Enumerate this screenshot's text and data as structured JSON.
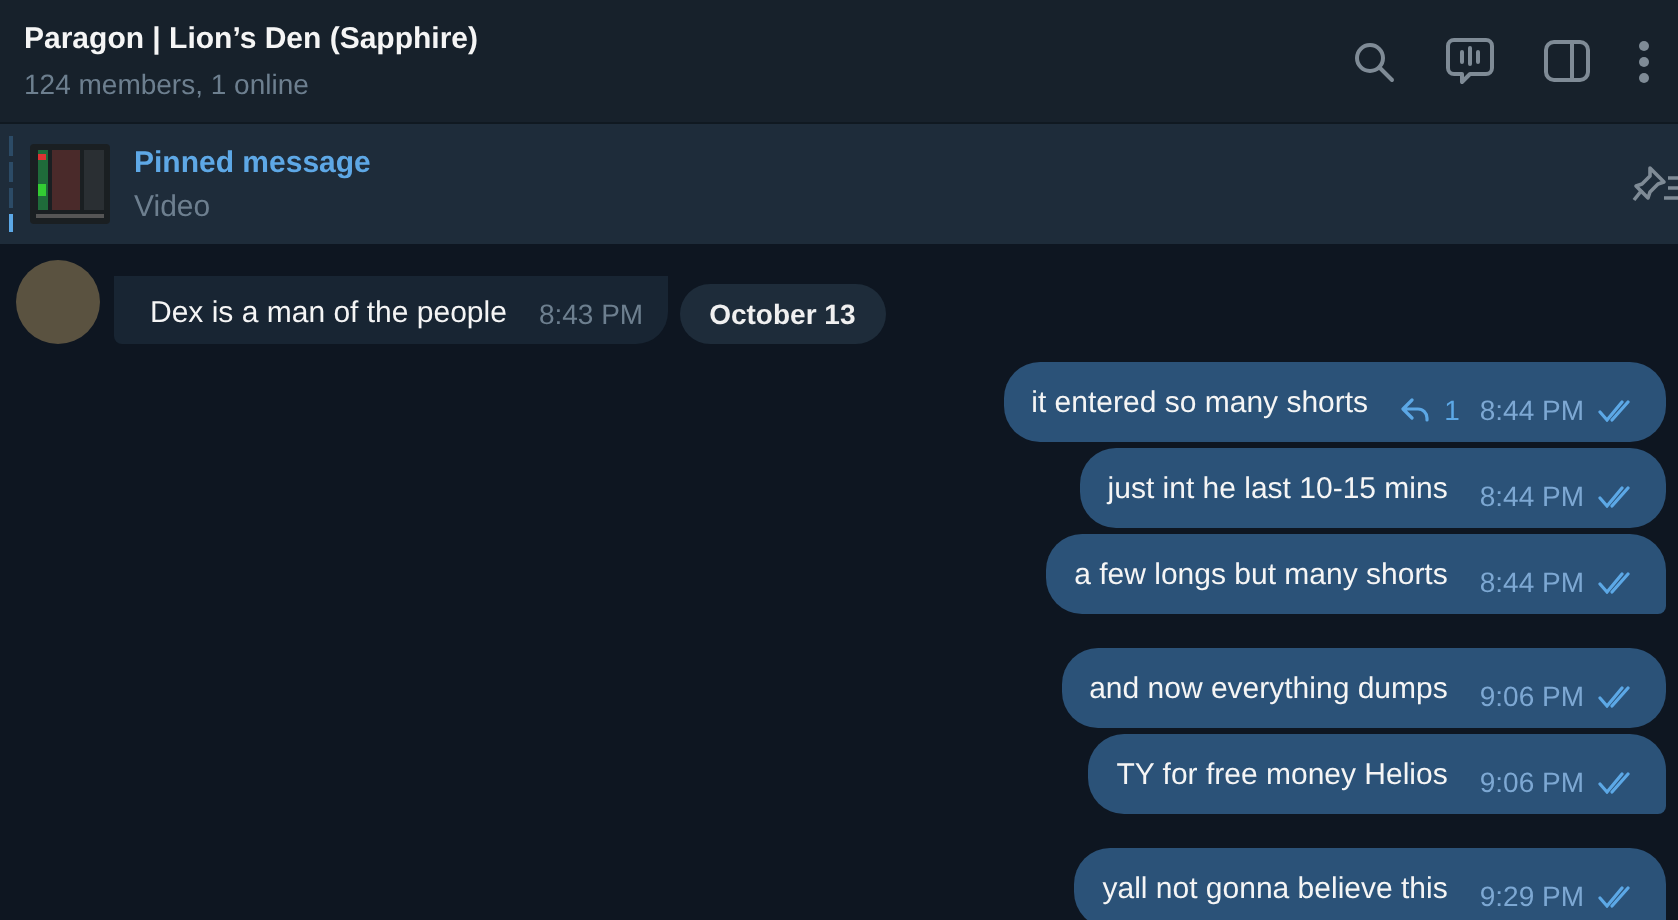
{
  "header": {
    "title": "Paragon | Lion’s Den (Sapphire)",
    "subtitle": "124 members, 1 online"
  },
  "pinned": {
    "title": "Pinned message",
    "subtitle": "Video"
  },
  "incoming": {
    "text": "Dex is a man of the people",
    "time": "8:43 PM"
  },
  "date_badge": "October 13",
  "groups": [
    {
      "messages": [
        {
          "text": "it entered so many shorts",
          "replies": "1",
          "time": "8:44 PM",
          "read": true
        },
        {
          "text": "just int he last 10-15 mins",
          "time": "8:44 PM",
          "read": true
        },
        {
          "text": "a few longs but many shorts",
          "time": "8:44 PM",
          "read": true
        }
      ]
    },
    {
      "messages": [
        {
          "text": "and now everything dumps",
          "time": "9:06 PM",
          "read": true
        },
        {
          "text": "TY for free money Helios",
          "time": "9:06 PM",
          "read": true
        }
      ]
    },
    {
      "messages": [
        {
          "text": "yall not gonna believe this",
          "time": "9:29 PM",
          "read": true
        }
      ]
    }
  ]
}
